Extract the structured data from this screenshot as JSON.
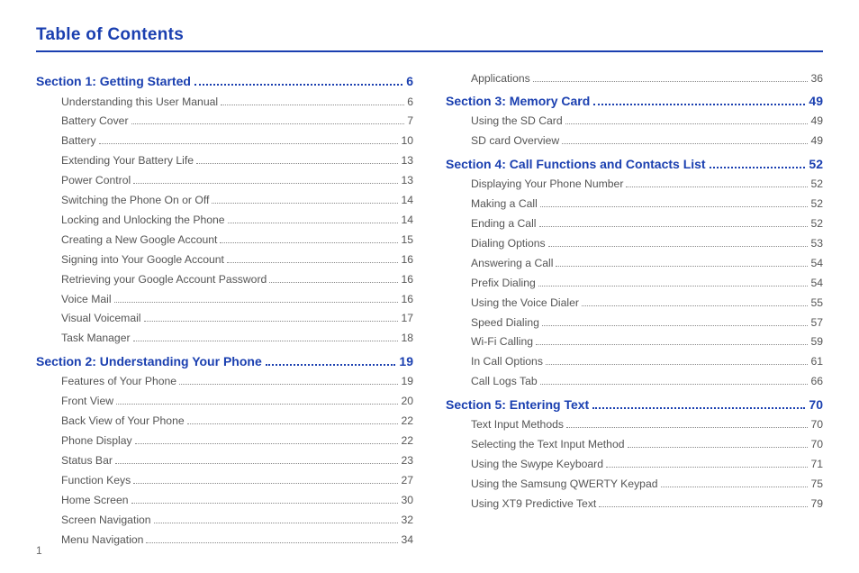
{
  "title": "Table of Contents",
  "page_number": "1",
  "columns": [
    [
      {
        "type": "section",
        "label": "Section 1:  Getting Started",
        "page": "6"
      },
      {
        "type": "entry",
        "label": "Understanding this User Manual",
        "page": "6"
      },
      {
        "type": "entry",
        "label": "Battery Cover",
        "page": "7"
      },
      {
        "type": "entry",
        "label": "Battery",
        "page": "10"
      },
      {
        "type": "entry",
        "label": "Extending Your Battery Life",
        "page": "13"
      },
      {
        "type": "entry",
        "label": "Power Control",
        "page": "13"
      },
      {
        "type": "entry",
        "label": "Switching the Phone On or Off",
        "page": "14"
      },
      {
        "type": "entry",
        "label": "Locking and Unlocking the Phone",
        "page": "14"
      },
      {
        "type": "entry",
        "label": "Creating a New Google Account",
        "page": "15"
      },
      {
        "type": "entry",
        "label": "Signing into Your Google Account",
        "page": "16"
      },
      {
        "type": "entry",
        "label": "Retrieving your Google Account Password",
        "page": "16"
      },
      {
        "type": "entry",
        "label": "Voice Mail",
        "page": "16"
      },
      {
        "type": "entry",
        "label": "Visual Voicemail",
        "page": "17"
      },
      {
        "type": "entry",
        "label": "Task Manager",
        "page": "18"
      },
      {
        "type": "section",
        "label": "Section 2:  Understanding Your Phone",
        "page": "19"
      },
      {
        "type": "entry",
        "label": "Features of Your Phone",
        "page": "19"
      },
      {
        "type": "entry",
        "label": "Front View",
        "page": "20"
      },
      {
        "type": "entry",
        "label": "Back View of Your Phone",
        "page": "22"
      },
      {
        "type": "entry",
        "label": "Phone Display",
        "page": "22"
      },
      {
        "type": "entry",
        "label": "Status Bar",
        "page": "23"
      },
      {
        "type": "entry",
        "label": "Function Keys",
        "page": "27"
      },
      {
        "type": "entry",
        "label": "Home Screen",
        "page": "30"
      },
      {
        "type": "entry",
        "label": "Screen Navigation",
        "page": "32"
      },
      {
        "type": "entry",
        "label": "Menu Navigation",
        "page": "34"
      }
    ],
    [
      {
        "type": "entry",
        "label": "Applications",
        "page": "36"
      },
      {
        "type": "section",
        "label": "Section 3:  Memory Card",
        "page": "49"
      },
      {
        "type": "entry",
        "label": "Using the SD Card",
        "page": "49"
      },
      {
        "type": "entry",
        "label": "SD card Overview",
        "page": "49"
      },
      {
        "type": "section",
        "label": "Section 4:  Call Functions and Contacts List",
        "page": "52"
      },
      {
        "type": "entry",
        "label": "Displaying Your Phone Number",
        "page": "52"
      },
      {
        "type": "entry",
        "label": "Making a Call",
        "page": "52"
      },
      {
        "type": "entry",
        "label": "Ending a Call",
        "page": "52"
      },
      {
        "type": "entry",
        "label": "Dialing Options",
        "page": "53"
      },
      {
        "type": "entry",
        "label": "Answering a Call",
        "page": "54"
      },
      {
        "type": "entry",
        "label": "Prefix Dialing",
        "page": "54"
      },
      {
        "type": "entry",
        "label": "Using the Voice Dialer",
        "page": "55"
      },
      {
        "type": "entry",
        "label": "Speed Dialing",
        "page": "57"
      },
      {
        "type": "entry",
        "label": "Wi-Fi Calling",
        "page": "59"
      },
      {
        "type": "entry",
        "label": "In Call Options",
        "page": "61"
      },
      {
        "type": "entry",
        "label": "Call Logs Tab",
        "page": "66"
      },
      {
        "type": "section",
        "label": "Section 5:  Entering Text",
        "page": "70"
      },
      {
        "type": "entry",
        "label": "Text Input Methods",
        "page": "70"
      },
      {
        "type": "entry",
        "label": "Selecting the Text Input Method",
        "page": "70"
      },
      {
        "type": "entry",
        "label": "Using the Swype Keyboard",
        "page": "71"
      },
      {
        "type": "entry",
        "label": "Using the Samsung QWERTY Keypad",
        "page": "75"
      },
      {
        "type": "entry",
        "label": "Using XT9 Predictive Text",
        "page": "79"
      }
    ]
  ]
}
